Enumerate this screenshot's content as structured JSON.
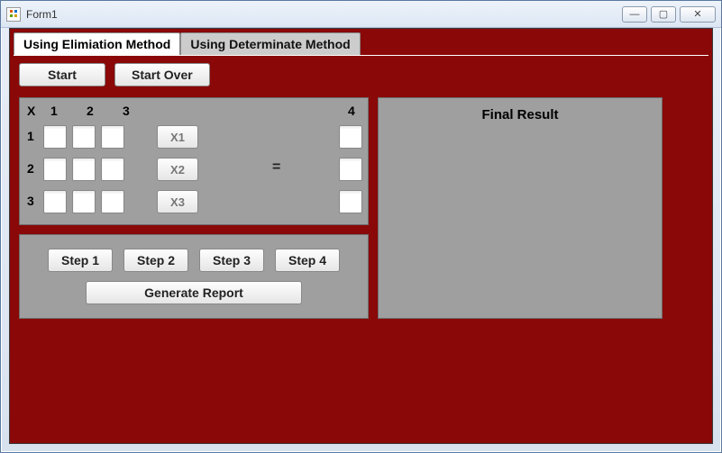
{
  "window": {
    "title": "Form1",
    "min": "—",
    "max": "▢",
    "close": "✕"
  },
  "tabs": {
    "t1": "Using Elimiation Method",
    "t2": "Using Determinate Method"
  },
  "toolbar": {
    "start": "Start",
    "startover": "Start Over"
  },
  "matrix": {
    "corner": "X",
    "h1": "1",
    "h2": "2",
    "h3": "3",
    "h4": "4",
    "r1": "1",
    "r2": "2",
    "r3": "3",
    "x1": "X1",
    "x2": "X2",
    "x3": "X3",
    "eq": "="
  },
  "steps": {
    "s1": "Step 1",
    "s2": "Step 2",
    "s3": "Step 3",
    "s4": "Step 4",
    "gen": "Generate Report"
  },
  "result": {
    "title": "Final Result"
  }
}
